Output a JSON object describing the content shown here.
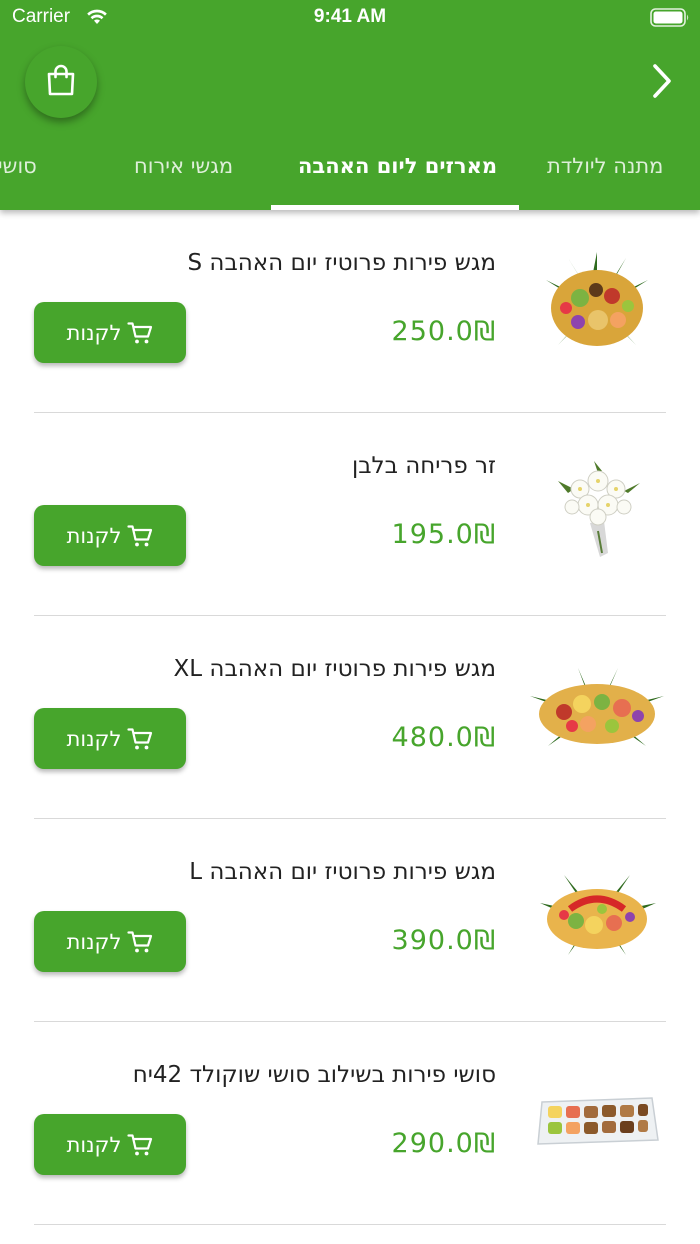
{
  "status_bar": {
    "carrier": "Carrier",
    "time": "9:41 AM"
  },
  "header": {
    "cart_icon": "shopping-bag-icon",
    "forward_icon": "chevron-right-icon",
    "background_color": "#47a52c"
  },
  "tabs": [
    {
      "label": "מתנה ליולדת",
      "active": false
    },
    {
      "label": "מארזים ליום האהבה",
      "active": true
    },
    {
      "label": "מגשי אירוח",
      "active": false
    },
    {
      "label": "סושי פירות",
      "active": false
    }
  ],
  "buy_label": "לקנות",
  "products": [
    {
      "name": "מגש פירות פרוטיז יום האהבה S",
      "price": "250.0₪",
      "image": "round-fruit-platter"
    },
    {
      "name": "זר פריחה בלבן",
      "price": "195.0₪",
      "image": "white-flower-bouquet"
    },
    {
      "name": "מגש פירות פרוטיז יום האהבה XL",
      "price": "480.0₪",
      "image": "large-fruit-platter"
    },
    {
      "name": "מגש פירות פרוטיז יום האהבה L",
      "price": "390.0₪",
      "image": "fruit-platter-l"
    },
    {
      "name": "סושי פירות בשילוב סושי שוקולד 42יח",
      "price": "290.0₪",
      "image": "fruit-sushi-tray"
    }
  ]
}
